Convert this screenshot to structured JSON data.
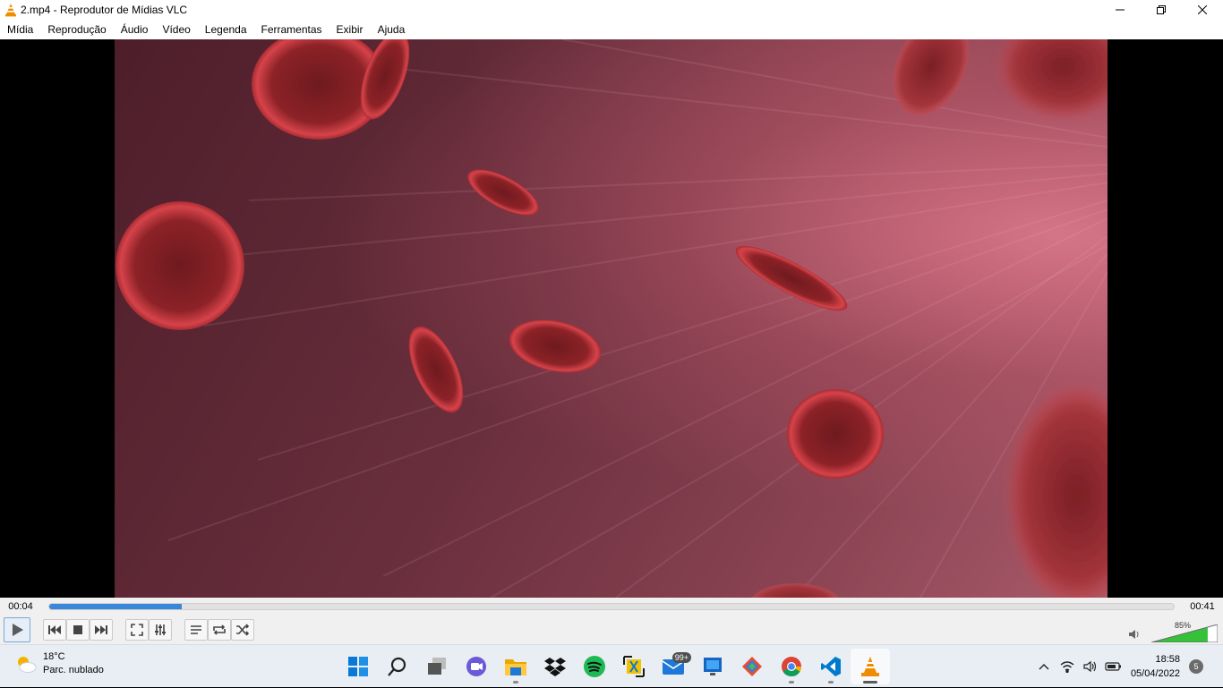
{
  "window": {
    "title": "2.mp4 - Reprodutor de Mídias VLC"
  },
  "menu": [
    "Mídia",
    "Reprodução",
    "Áudio",
    "Vídeo",
    "Legenda",
    "Ferramentas",
    "Exibir",
    "Ajuda"
  ],
  "player": {
    "time_elapsed": "00:04",
    "time_total": "00:41",
    "progress": 0.118,
    "volume_label": "85%",
    "volume": 0.85
  },
  "icons": {
    "app": "vlc-cone-icon",
    "window_controls": [
      "minimize-icon",
      "restore-icon",
      "close-icon"
    ],
    "playback": [
      "play-icon",
      "previous-icon",
      "stop-icon",
      "next-icon",
      "fullscreen-icon",
      "extended-settings-icon",
      "playlist-icon",
      "loop-icon",
      "shuffle-icon"
    ]
  },
  "taskbar": {
    "weather": {
      "temperature": "18°C",
      "condition": "Parc. nublado"
    },
    "apps": [
      {
        "name": "start-icon"
      },
      {
        "name": "search-icon"
      },
      {
        "name": "task-view-icon"
      },
      {
        "name": "chat-icon"
      },
      {
        "name": "file-explorer-icon",
        "running": true
      },
      {
        "name": "dropbox-icon"
      },
      {
        "name": "spotify-icon"
      },
      {
        "name": "snip-tool-icon"
      },
      {
        "name": "mail-icon",
        "badge": "99+"
      },
      {
        "name": "remote-desktop-icon"
      },
      {
        "name": "git-icon"
      },
      {
        "name": "chrome-icon",
        "running": true
      },
      {
        "name": "vscode-icon",
        "running": true
      },
      {
        "name": "vlc-icon",
        "running": true,
        "active": true
      }
    ],
    "tray": {
      "time": "18:58",
      "date": "05/04/2022",
      "notifications": "5"
    }
  },
  "colors": {
    "seek_fill": "#3a86d8",
    "volume_fill": "#37c13a",
    "accent": "#0078d4"
  }
}
